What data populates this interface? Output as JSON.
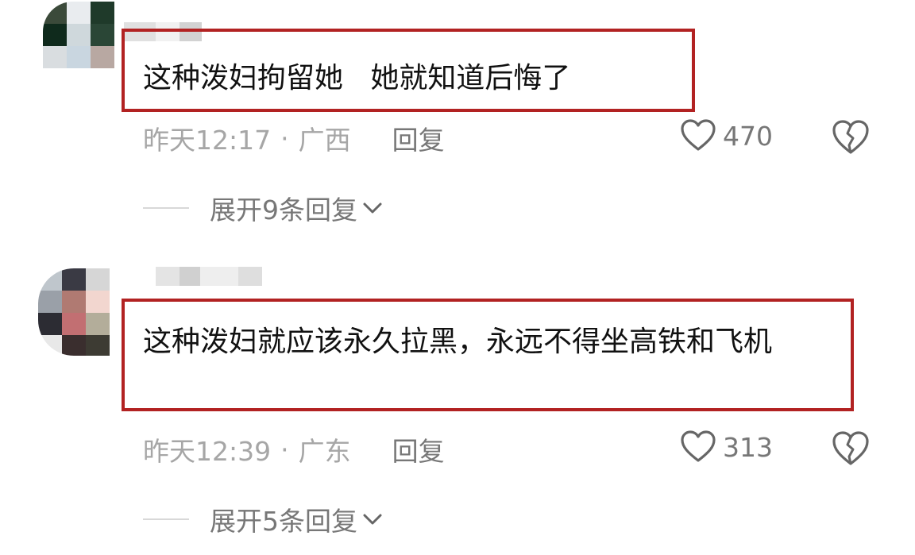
{
  "comments": [
    {
      "text": "这种泼妇拘留她   她就知道后悔了",
      "time": "昨天12:17",
      "location": "广西",
      "separator": "·",
      "reply_label": "回复",
      "likes": "470",
      "expand_label": "展开9条回复"
    },
    {
      "text": "这种泼妇就应该永久拉黑，永远不得坐高铁和飞机",
      "time": "昨天12:39",
      "location": "广东",
      "separator": "·",
      "reply_label": "回复",
      "likes": "313",
      "expand_label": "展开5条回复"
    }
  ],
  "colors": {
    "highlight_box": "#b22222",
    "meta_text": "#a6a6a6",
    "secondary_text": "#777777"
  },
  "icons": {
    "like": "heart-outline-icon",
    "dislike": "broken-heart-icon",
    "expand": "chevron-down-icon"
  }
}
